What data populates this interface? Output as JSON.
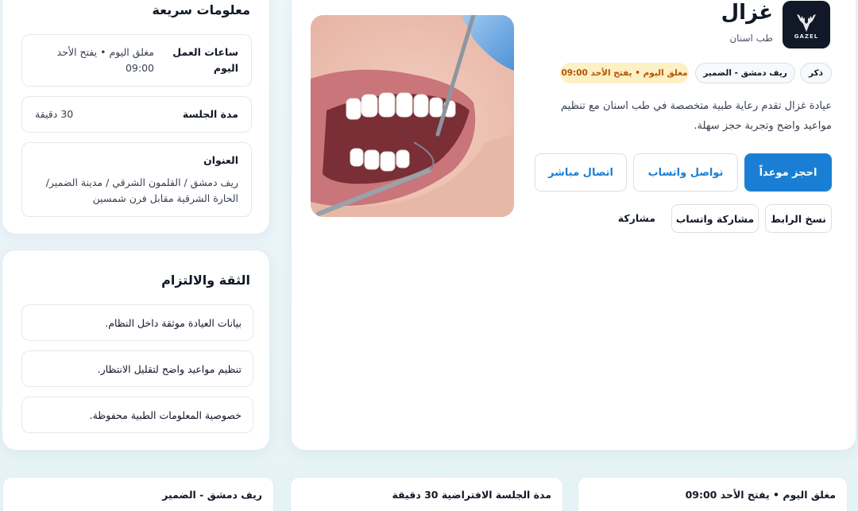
{
  "quick_info": {
    "title": "معلومات سريعة",
    "hours_label": "ساعات العمل اليوم",
    "hours_value": "مغلق اليوم • يفتح الأحد 09:00",
    "session_label": "مدة الجلسة",
    "session_value": "30 دقيقة",
    "address_label": "العنوان",
    "address_value": "ريف دمشق / القلمون الشرقي / مدينة الضمير/ الحارة الشرقية مقابل فرن شمسين"
  },
  "trust": {
    "title": "الثقة والالتزام",
    "items": [
      "بيانات العيادة موثقة داخل النظام.",
      "تنظيم مواعيد واضح لتقليل الانتظار.",
      "خصوصية المعلومات الطبية محفوظة."
    ]
  },
  "clinic": {
    "name": "غزال",
    "specialty": "طب اسنان",
    "logo_text": "GAZEL",
    "tags": {
      "gender": "ذكر",
      "location": "ريف دمشق - الضمير",
      "status": "مغلق اليوم • يفتح الأحد 09:00"
    },
    "description": "عيادة غزال تقدم رعاية طبية متخصصة في طب اسنان مع تنظيم مواعيد واضح وتجربة حجز سهلة.",
    "buttons": {
      "book": "احجز موعداً",
      "whatsapp": "تواصل واتساب",
      "call": "اتصال مباشر"
    },
    "share": {
      "copy_link": "نسخ الرابط",
      "share_whatsapp": "مشاركة واتساب",
      "share_label": "مشاركة"
    }
  },
  "bottom": {
    "hours": "مغلق اليوم • يفتح الأحد 09:00",
    "session": "مدة الجلسة الافتراضية 30 دقيقة",
    "location": "ريف دمشق - الضمير"
  },
  "colors": {
    "primary": "#1a7fd4",
    "warn_bg": "#fdf0c3",
    "warn_text": "#b45309"
  }
}
